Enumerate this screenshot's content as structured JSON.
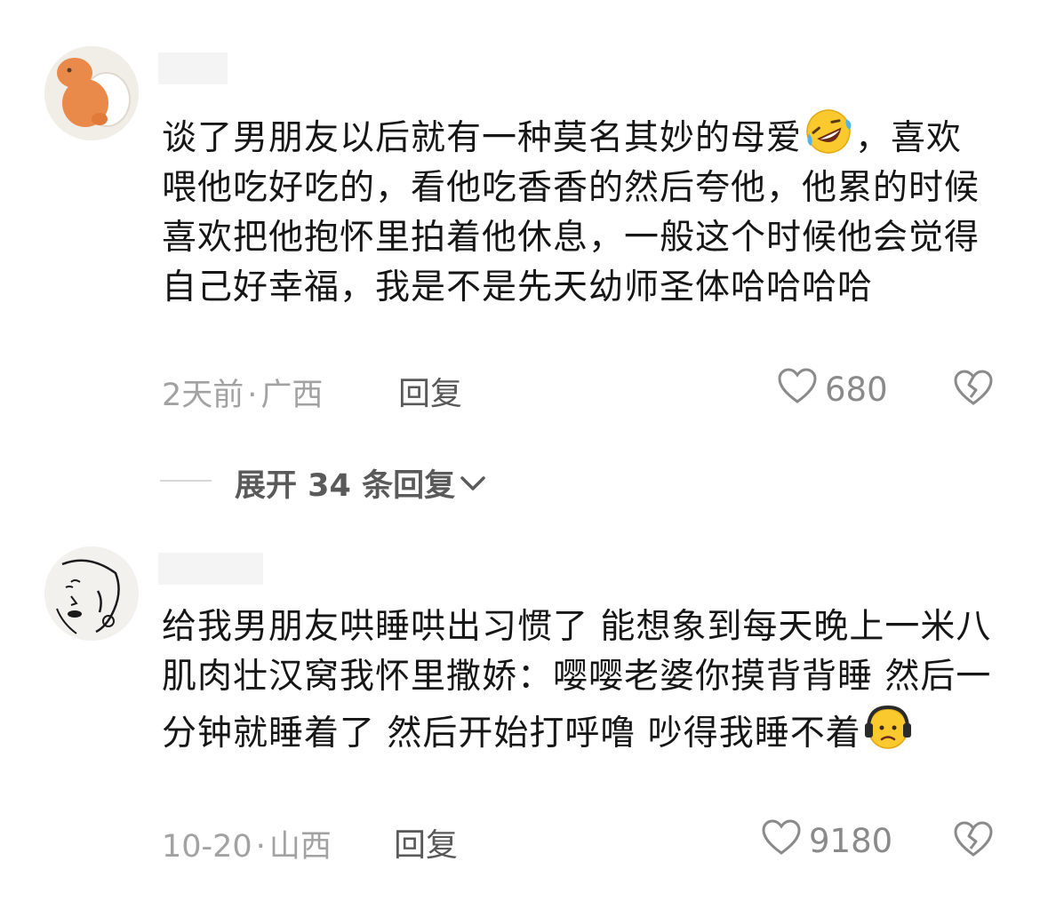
{
  "comments": [
    {
      "text_before_emoji": "谈了男朋友以后就有一种莫名其妙的母爱",
      "text_after_emoji": "，喜欢喂他吃好吃的，看他吃香香的然后夸他，他累的时候喜欢把他抱怀里拍着他休息，一般这个时候他会觉得自己好幸福，我是不是先天幼师圣体哈哈哈哈",
      "emoji": "rolling-laughing-emoji",
      "time": "2天前",
      "location": "广西",
      "reply_label": "回复",
      "likes": "680",
      "replies_expand": "展开 34 条回复"
    },
    {
      "text_before_emoji": "给我男朋友哄睡哄出习惯了 能想象到每天晚上一米八肌肉壮汉窝我怀里撒娇：嘤嘤老婆你摸背背睡 然后一分钟就睡着了 然后开始打呼噜 吵得我睡不着",
      "text_after_emoji": "",
      "emoji": "headphones-frown-emoji",
      "time": "10-20",
      "location": "山西",
      "reply_label": "回复",
      "likes": "9180"
    }
  ],
  "colors": {
    "meta": "#a2a2a2",
    "emoji_yellow": "#f9c92e"
  },
  "meta_separator": "·"
}
